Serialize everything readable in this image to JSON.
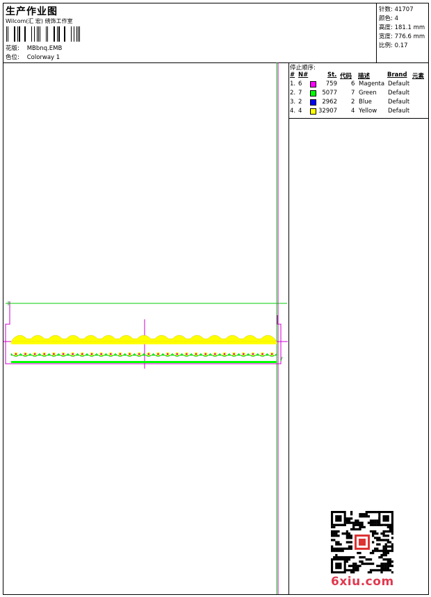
{
  "header": {
    "title": "生产作业图",
    "company": "Wilcom(汇 宏) 绣饰工作室",
    "design_label": "花版:",
    "design_file": "MBbnq.EMB",
    "colorway_label": "色位:",
    "colorway": "Colorway 1"
  },
  "stats": [
    {
      "label": "针数:",
      "value": "41707"
    },
    {
      "label": "颜色:",
      "value": "4"
    },
    {
      "label": "高度:",
      "value": "181.1 mm"
    },
    {
      "label": "宽度:",
      "value": "776.6 mm"
    },
    {
      "label": "比例:",
      "value": "0.17"
    }
  ],
  "stop_sequence": {
    "title": "停止顺序:",
    "headers": {
      "num": "#",
      "n": "N#",
      "st": "St.",
      "code": "代码",
      "desc": "描述",
      "brand": "Brand",
      "elem": "元素"
    },
    "rows": [
      {
        "num": "1.",
        "n": "6",
        "color": "#ff00ff",
        "st": "759",
        "code": "6",
        "desc": "Magenta",
        "brand": "Default"
      },
      {
        "num": "2.",
        "n": "7",
        "color": "#00ff00",
        "st": "5077",
        "code": "7",
        "desc": "Green",
        "brand": "Default"
      },
      {
        "num": "3.",
        "n": "2",
        "color": "#0000ff",
        "st": "2962",
        "code": "2",
        "desc": "Blue",
        "brand": "Default"
      },
      {
        "num": "4.",
        "n": "4",
        "color": "#ffff00",
        "st": "32907",
        "code": "4",
        "desc": "Yellow",
        "brand": "Default"
      }
    ]
  },
  "watermark": "6xiu.com",
  "colors": {
    "guide_green": "#00cc00",
    "guide_magenta": "#cc00cc",
    "embroidery_yellow": "#ffff00",
    "embroidery_green": "#00ff00"
  }
}
